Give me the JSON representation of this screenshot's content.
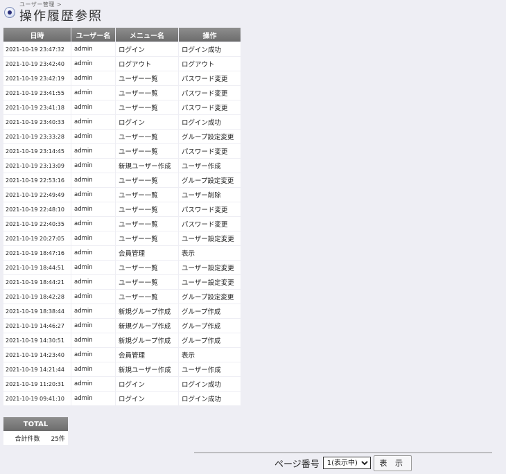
{
  "breadcrumb": "ユーザー管理 >",
  "title": "操作履歴参照",
  "table": {
    "headers": [
      "日時",
      "ユーザー名",
      "メニュー名",
      "操作"
    ],
    "rows": [
      [
        "2021-10-19 23:47:32",
        "admin",
        "ログイン",
        "ログイン成功"
      ],
      [
        "2021-10-19 23:42:40",
        "admin",
        "ログアウト",
        "ログアウト"
      ],
      [
        "2021-10-19 23:42:19",
        "admin",
        "ユーザー一覧",
        "パスワード変更"
      ],
      [
        "2021-10-19 23:41:55",
        "admin",
        "ユーザー一覧",
        "パスワード変更"
      ],
      [
        "2021-10-19 23:41:18",
        "admin",
        "ユーザー一覧",
        "パスワード変更"
      ],
      [
        "2021-10-19 23:40:33",
        "admin",
        "ログイン",
        "ログイン成功"
      ],
      [
        "2021-10-19 23:33:28",
        "admin",
        "ユーザー一覧",
        "グループ設定変更"
      ],
      [
        "2021-10-19 23:14:45",
        "admin",
        "ユーザー一覧",
        "パスワード変更"
      ],
      [
        "2021-10-19 23:13:09",
        "admin",
        "新規ユーザー作成",
        "ユーザー作成"
      ],
      [
        "2021-10-19 22:53:16",
        "admin",
        "ユーザー一覧",
        "グループ設定変更"
      ],
      [
        "2021-10-19 22:49:49",
        "admin",
        "ユーザー一覧",
        "ユーザー削除"
      ],
      [
        "2021-10-19 22:48:10",
        "admin",
        "ユーザー一覧",
        "パスワード変更"
      ],
      [
        "2021-10-19 22:40:35",
        "admin",
        "ユーザー一覧",
        "パスワード変更"
      ],
      [
        "2021-10-19 20:27:05",
        "admin",
        "ユーザー一覧",
        "ユーザー設定変更"
      ],
      [
        "2021-10-19 18:47:16",
        "admin",
        "会員管理",
        "表示"
      ],
      [
        "2021-10-19 18:44:51",
        "admin",
        "ユーザー一覧",
        "ユーザー設定変更"
      ],
      [
        "2021-10-19 18:44:21",
        "admin",
        "ユーザー一覧",
        "ユーザー設定変更"
      ],
      [
        "2021-10-19 18:42:28",
        "admin",
        "ユーザー一覧",
        "グループ設定変更"
      ],
      [
        "2021-10-19 18:38:44",
        "admin",
        "新規グループ作成",
        "グループ作成"
      ],
      [
        "2021-10-19 14:46:27",
        "admin",
        "新規グループ作成",
        "グループ作成"
      ],
      [
        "2021-10-19 14:30:51",
        "admin",
        "新規グループ作成",
        "グループ作成"
      ],
      [
        "2021-10-19 14:23:40",
        "admin",
        "会員管理",
        "表示"
      ],
      [
        "2021-10-19 14:21:44",
        "admin",
        "新規ユーザー作成",
        "ユーザー作成"
      ],
      [
        "2021-10-19 11:20:31",
        "admin",
        "ログイン",
        "ログイン成功"
      ],
      [
        "2021-10-19 09:41:10",
        "admin",
        "ログイン",
        "ログイン成功"
      ]
    ]
  },
  "total": {
    "header": "TOTAL",
    "label": "合計件数",
    "value": "25件"
  },
  "pager": {
    "label": "ページ番号",
    "selected": "1(表示中)",
    "button": "表 示"
  }
}
